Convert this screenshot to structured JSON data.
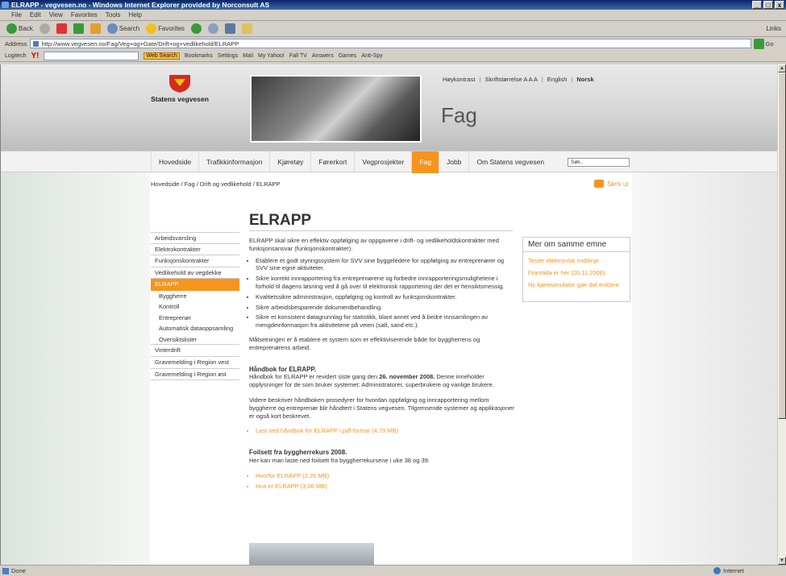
{
  "window": {
    "title": "ELRAPP - vegvesen.no - Windows Internet Explorer provided by Norconsult AS"
  },
  "menubar": [
    "File",
    "Edit",
    "View",
    "Favorites",
    "Tools",
    "Help"
  ],
  "toolbar": {
    "back": "Back",
    "search": "Search",
    "favorites": "Favorites",
    "links": "Links"
  },
  "address": {
    "label": "Address",
    "url": "http://www.vegvesen.no/Fag/Veg+og+Gate/Drift+og+vedlikehold/ELRAPP",
    "go": "Go"
  },
  "linksbar": {
    "logitech": "Logitech",
    "web_search": "Web Search",
    "bookmarks": "Bookmarks",
    "settings": "Settings",
    "mail": "Mail",
    "my_yahoo": "My Yahoo!",
    "fall_tv": "Fall TV",
    "answers": "Answers",
    "games": "Games",
    "antispy": "Anti-Spy"
  },
  "site": {
    "logo_text": "Statens vegvesen",
    "section_title": "Fag",
    "toplinks": {
      "contrast": "Høykontrast",
      "font_size": "Skriftstørrelse A A A",
      "english": "English",
      "norsk": "Norsk"
    },
    "nav": [
      "Hovedside",
      "Trafikkinformasjon",
      "Kjøretøy",
      "Førerkort",
      "Vegprosjekter",
      "Fag",
      "Jobb",
      "Om Statens vegvesen"
    ],
    "search_placeholder": "Søk..",
    "breadcrumb": "Hovedside / Fag / Drift og vedlikehold / ELRAPP",
    "print": "Skriv ut",
    "page_title": "ELRAPP",
    "leftnav": [
      "Arbeidsvarsling",
      "Elektrokontrakter",
      "Funksjonskontrakter",
      "Vedlikehold av vegdekke",
      "ELRAPP",
      "Byggherre",
      "Kontroll",
      "Entreprenør",
      "Automatisk dataoppsamling",
      "Oversiktslister",
      "Vinterdrift",
      "Gravemelding i Region vest",
      "Gravemelding i Region øst"
    ],
    "content": {
      "intro": "ELRAPP skal sikre en effektiv oppfølging av oppgavene i drift- og vedlikeholdskontrakter med funksjonsansvar (funksjonskontrakter).",
      "bullets": [
        "Etablere et godt styringssystem for SVV sine byggeledere for oppfølging av entreprenører og SVV sine egne aktiviteter.",
        "Sikre korrekt innrapportering fra entreprenørene og forbedre innrapporteringsmulighetene i forhold til dagens løsning ved å gå over til elektronisk rapportering der det er hensiktsmessig.",
        "Kvalitetssikre administrasjon, oppfølging og kontroll av funksjonskontrakter.",
        "Sikre arbeidsbesparende dokumentbehandling.",
        "Sikre et konsistent datagrunnlag for statistikk, blant annet ved å bedre innsamlingen av mengdeinformasjon fra aktivitetene på veien (salt, sand etc.)."
      ],
      "goal": "Målsetningen er å etablere et system som er effektiviserende både for byggherrens og entreprenørens arbeid.",
      "handbook_heading": "Håndbok for ELRAPP.",
      "handbook_text_a": "Håndbok for ELRAPP er revidert siste gang den ",
      "handbook_date": "26. november 2008.",
      "handbook_text_b": " Denne inneholder opplysninger for de som bruker systemet: Administratorer, superbrukere og vanlige brukere.",
      "handbook_text2": "Videre beskriver håndboken prosedyrer for hvordan oppfølging og innrapportering mellom byggherre og entreprenør blir håndtert i Statens vegvesen. Tilgrensende systemer og applikasjoner er også kort beskrevet.",
      "handbook_link": "Last ned håndbok for ELRAPP i pdf-format (4,79 MB)",
      "slides_heading": "Foilsett fra byggherrekurs 2008.",
      "slides_text": "Her kan man laste ned foilsett fra byggherrekursene i uke 38 og 39:",
      "slide_links": [
        "Hvorfor ELRAPP (2,20 MB)",
        "Hva er ELRAPP (3,06 MB)"
      ]
    },
    "sidebox": {
      "title": "Mer om samme emne",
      "links": [
        "Tester elektronisk midtlinje",
        "Framtida er her (20.11.2008)",
        "Ny kjøresimulator gjør det enklere"
      ]
    }
  },
  "status": {
    "text": "Done",
    "zone": "Internet"
  }
}
